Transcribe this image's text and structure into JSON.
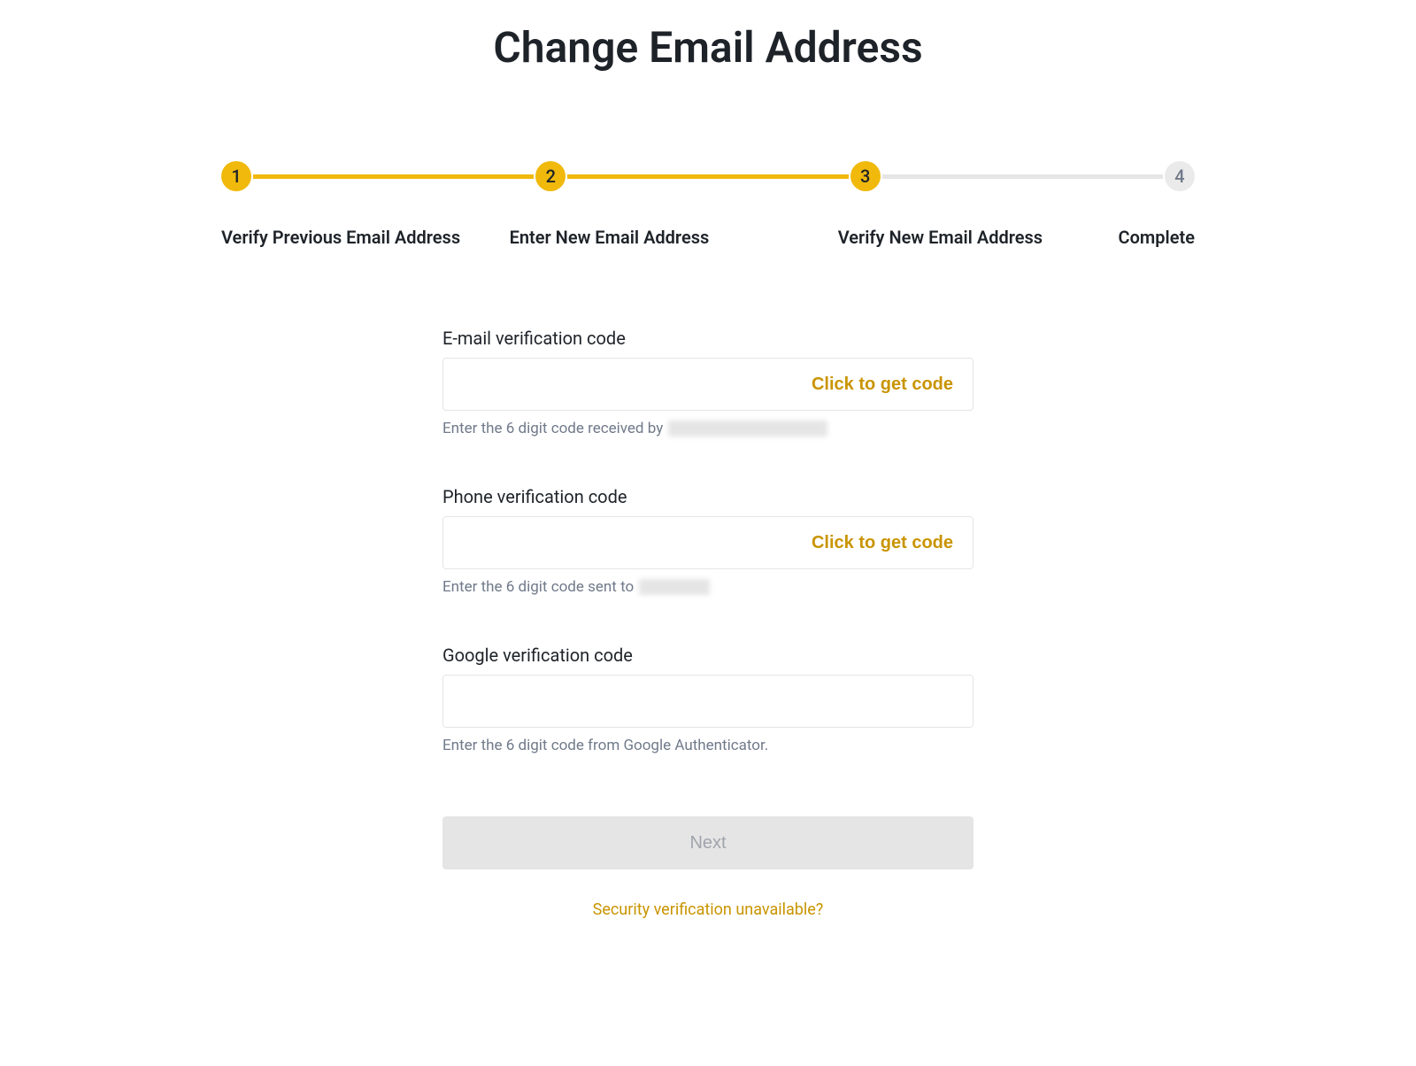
{
  "page_title": "Change Email Address",
  "stepper": {
    "steps": [
      {
        "number": "1",
        "label": "Verify Previous Email Address",
        "active": true
      },
      {
        "number": "2",
        "label": "Enter New Email Address",
        "active": true
      },
      {
        "number": "3",
        "label": "Verify New Email Address",
        "active": true
      },
      {
        "number": "4",
        "label": "Complete",
        "active": false
      }
    ]
  },
  "form": {
    "email_verification": {
      "label": "E-mail verification code",
      "get_code_label": "Click to get code",
      "hint_prefix": "Enter the 6 digit code received by"
    },
    "phone_verification": {
      "label": "Phone verification code",
      "get_code_label": "Click to get code",
      "hint_prefix": "Enter the 6 digit code sent to"
    },
    "google_verification": {
      "label": "Google verification code",
      "hint": "Enter the 6 digit code from Google Authenticator."
    },
    "next_button": "Next",
    "security_link": "Security verification unavailable?"
  }
}
